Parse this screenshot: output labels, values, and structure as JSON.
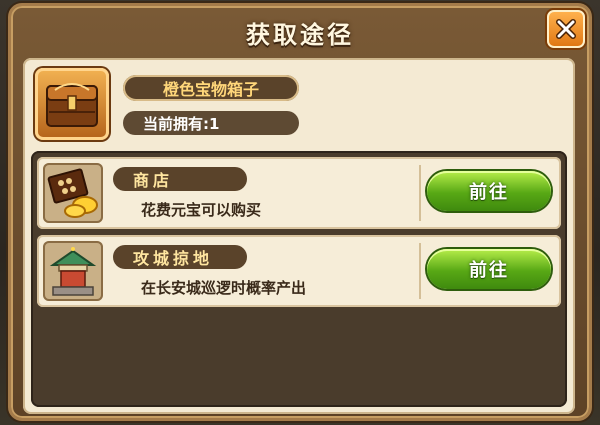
{
  "dialog": {
    "title": "获取途径",
    "close_icon": "close-x-icon"
  },
  "item": {
    "name": "橙色宝物箱子",
    "owned_label": "当前拥有:1",
    "icon": "orange-treasure-chest-icon"
  },
  "sources": [
    {
      "title": "商店",
      "description": "花费元宝可以购买",
      "button_label": "前往",
      "icon": "shop-abacus-gold-icon"
    },
    {
      "title": "攻城掠地",
      "description": "在长安城巡逻时概率产出",
      "button_label": "前往",
      "icon": "city-pavilion-icon"
    }
  ],
  "colors": {
    "title_text": "#fff7e0",
    "close_button": "#e07814",
    "go_button": "#58a815",
    "item_name": "#ffd77a",
    "panel_bg": "#f4ead3"
  }
}
